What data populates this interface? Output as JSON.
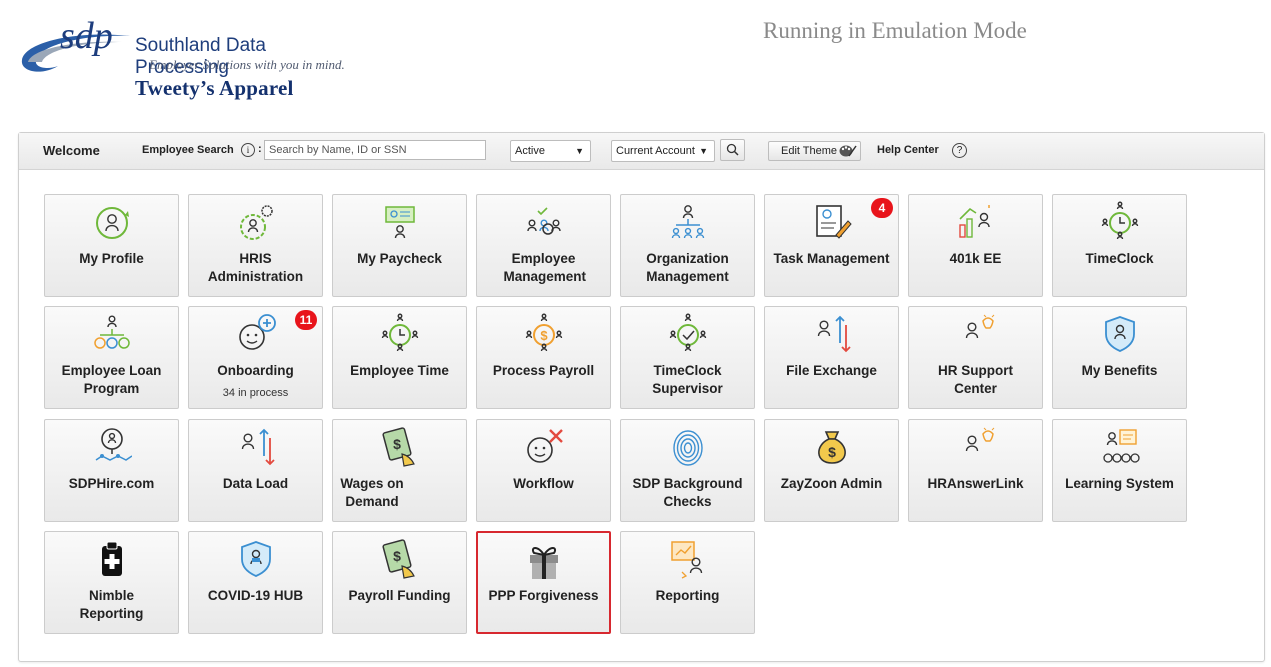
{
  "header": {
    "logo_mark": "sdp",
    "company_name": "Southland Data Processing",
    "tagline": "Employer Solutions with you in mind.",
    "client_name": "Tweety’s Apparel",
    "emulation_text": "Running in Emulation Mode"
  },
  "toolbar": {
    "welcome": "Welcome",
    "employee_search_label": "Employee Search",
    "info_icon_glyph": "i",
    "colon": ":",
    "search_placeholder": "Search by Name, ID or SSN",
    "status_value": "Active",
    "account_value": "Current Account",
    "edit_theme_label": "Edit Theme",
    "help_center_label": "Help Center",
    "help_icon_glyph": "?"
  },
  "tiles": [
    {
      "label": "My Profile",
      "icon": "profile-icon"
    },
    {
      "label": "HRIS Administration",
      "icon": "hris-admin-icon"
    },
    {
      "label": "My Paycheck",
      "icon": "paycheck-icon"
    },
    {
      "label": "Employee Management",
      "icon": "employee-management-icon"
    },
    {
      "label": "Organization Management",
      "icon": "organization-icon"
    },
    {
      "label": "Task Management",
      "icon": "task-icon",
      "badge": "4"
    },
    {
      "label": "401k EE",
      "icon": "401k-icon"
    },
    {
      "label": "TimeClock",
      "icon": "timeclock-icon"
    },
    {
      "label": "Employee Loan Program",
      "icon": "loan-icon"
    },
    {
      "label": "Onboarding",
      "icon": "onboarding-icon",
      "badge": "11",
      "sub": "34 in process"
    },
    {
      "label": "Employee Time",
      "icon": "employee-time-icon"
    },
    {
      "label": "Process Payroll",
      "icon": "process-payroll-icon"
    },
    {
      "label": "TimeClock Supervisor",
      "icon": "timeclock-supervisor-icon"
    },
    {
      "label": "File Exchange",
      "icon": "file-exchange-icon"
    },
    {
      "label": "HR Support Center",
      "icon": "hr-support-icon"
    },
    {
      "label": "My Benefits",
      "icon": "benefits-icon"
    },
    {
      "label": "SDPHire.com",
      "icon": "hire-icon"
    },
    {
      "label": "Data Load",
      "icon": "data-load-icon"
    },
    {
      "label": "Wages on Demand",
      "icon": "wages-icon"
    },
    {
      "label": "Workflow",
      "icon": "workflow-icon"
    },
    {
      "label": "SDP Background Checks",
      "icon": "fingerprint-icon"
    },
    {
      "label": "ZayZoon Admin",
      "icon": "money-bag-icon"
    },
    {
      "label": "HRAnswerLink",
      "icon": "hr-answer-icon"
    },
    {
      "label": "Learning System",
      "icon": "learning-icon"
    },
    {
      "label": "Nimble Reporting",
      "icon": "medical-clipboard-icon"
    },
    {
      "label": "COVID-19 HUB",
      "icon": "covid-shield-icon"
    },
    {
      "label": "Payroll Funding",
      "icon": "payroll-funding-icon"
    },
    {
      "label": "PPP Forgiveness",
      "icon": "gift-icon",
      "selected": true
    },
    {
      "label": "Reporting",
      "icon": "reporting-icon"
    }
  ],
  "colors": {
    "icon_blue": "#3b8fd1",
    "icon_green": "#6fb83a",
    "icon_orange": "#f0a030",
    "icon_red": "#e34a3f",
    "badge": "#e8141b",
    "selected_border": "#d7282f"
  }
}
